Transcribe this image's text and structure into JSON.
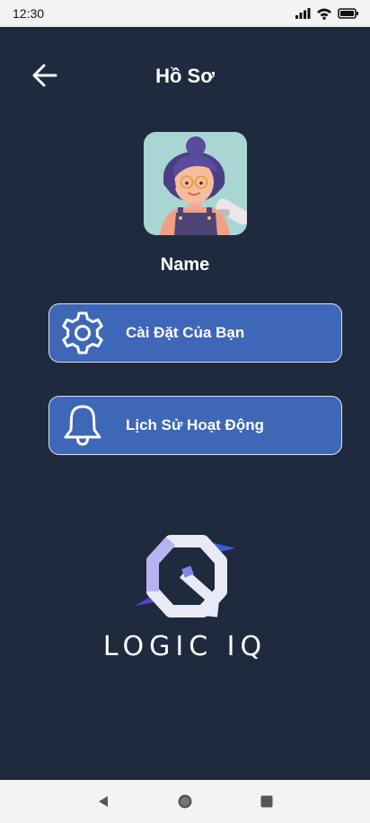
{
  "status_bar": {
    "time": "12:30",
    "icons": [
      "signal-icon",
      "wifi-icon",
      "battery-icon"
    ]
  },
  "header": {
    "title": "Hồ Sơ",
    "back_icon": "arrow-left-icon"
  },
  "profile": {
    "name": "Name",
    "avatar": "cartoon-girl-avatar"
  },
  "menu": [
    {
      "label": "Cài Đặt Của Bạn",
      "icon": "gear-icon"
    },
    {
      "label": "Lịch Sử Hoạt Động",
      "icon": "bell-icon"
    }
  ],
  "logo": {
    "text": "LOGIC IQ"
  },
  "nav_bar": {
    "icons": [
      "back-triangle-icon",
      "home-circle-icon",
      "recents-square-icon"
    ]
  },
  "colors": {
    "background": "#1f2a3e",
    "button": "#3e67b8",
    "button_border": "#d8e1f4",
    "system_bars": "#f3f3f5"
  }
}
